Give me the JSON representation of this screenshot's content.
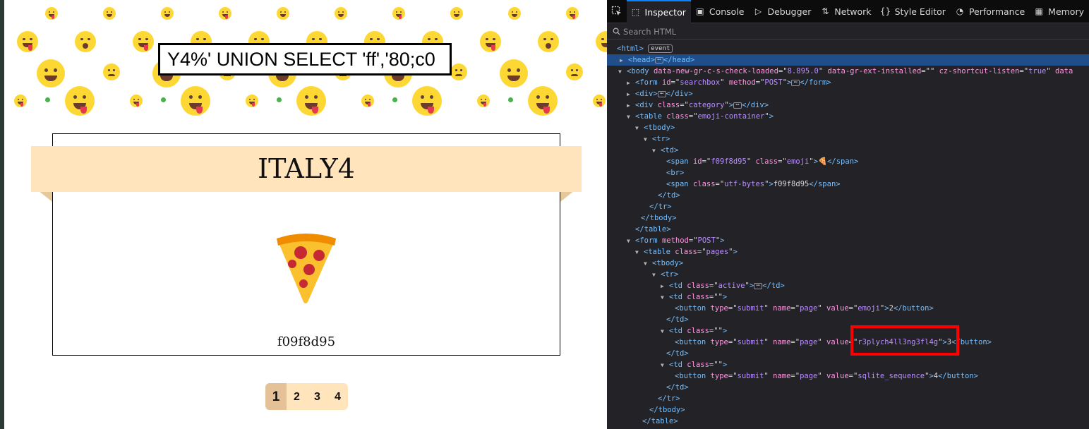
{
  "webpage": {
    "search_value": "Y4%' UNION SELECT 'ff','80;c0",
    "category_title": "ITALY4",
    "emoji_glyph": "🍕",
    "utf_bytes": "f09f8d95",
    "pages": [
      "1",
      "2",
      "3",
      "4"
    ],
    "active_page": "1"
  },
  "devtools": {
    "tabs": [
      {
        "icon": "inspector-icon",
        "label": "Inspector",
        "selected": true
      },
      {
        "icon": "console-icon",
        "label": "Console"
      },
      {
        "icon": "debugger-icon",
        "label": "Debugger"
      },
      {
        "icon": "network-icon",
        "label": "Network"
      },
      {
        "icon": "style-editor-icon",
        "label": "Style Editor"
      },
      {
        "icon": "performance-icon",
        "label": "Performance"
      },
      {
        "icon": "memory-icon",
        "label": "Memory"
      }
    ],
    "search_placeholder": "Search HTML",
    "badges": {
      "event": "event"
    },
    "nodes": {
      "body_attr1_name": "data-new-gr-c-s-check-loaded",
      "body_attr1_value": "8.895.0",
      "body_attr2_name": "data-gr-ext-installed",
      "body_attr2_value": "",
      "body_attr3_name": "cz-shortcut-listen",
      "body_attr3_value": "true",
      "body_attr4_name": "data",
      "searchbox_id": "searchbox",
      "method_post": "POST",
      "category_class": "category",
      "emoji_container_class": "emoji-container",
      "emoji_span_id": "f09f8d95",
      "emoji_span_class": "emoji",
      "emoji_span_text": "🍕",
      "utf_span_class": "utf-bytes",
      "utf_span_text": "f09f8d95",
      "pages_class": "pages",
      "active_class": "active",
      "empty_class": "",
      "button_type": "submit",
      "button_name": "page",
      "button2_value": "emoji",
      "button2_text": "2",
      "button3_value": "r3plych4ll3ng3fl4g",
      "button3_text": "3",
      "button4_value": "sqlite_sequence",
      "button4_text": "4"
    }
  },
  "colors": {
    "devtools_bg": "#232327",
    "selection_bg": "#204e8a",
    "tag_color": "#75bfff",
    "attr_name_color": "#ff97e1",
    "attr_value_color": "#b98eff",
    "ribbon_color": "#ffe4bc",
    "highlight_border": "#ff0000"
  }
}
